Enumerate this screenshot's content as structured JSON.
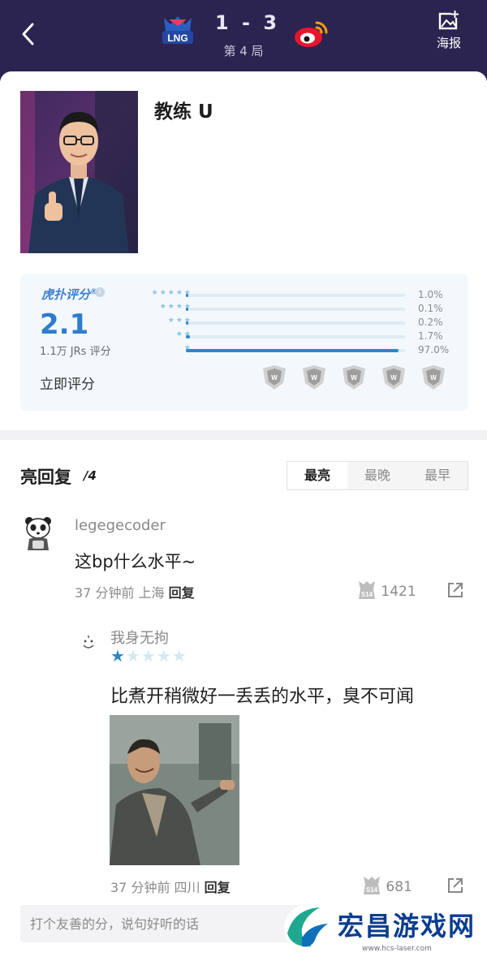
{
  "header": {
    "score": "1 - 3",
    "game_no": "第 4 局",
    "poster_label": "海报",
    "team_logo_text": "LNG",
    "bg_color": "#2b2350"
  },
  "profile": {
    "name": "教练 U"
  },
  "rating": {
    "brand": "虎扑评分",
    "brand_mark": "®",
    "score": "2.1",
    "count": "1.1万 JRs 评分",
    "rate_now": "立即评分",
    "accent_color": "#2f7ccc",
    "distribution": [
      {
        "stars": 5,
        "stars_label": "★★★★★",
        "percent": 1.0,
        "label": "1.0%"
      },
      {
        "stars": 4,
        "stars_label": "★★★★",
        "percent": 0.1,
        "label": "0.1%"
      },
      {
        "stars": 3,
        "stars_label": "★★★",
        "percent": 0.2,
        "label": "0.2%"
      },
      {
        "stars": 2,
        "stars_label": "★★",
        "percent": 1.7,
        "label": "1.7%"
      },
      {
        "stars": 1,
        "stars_label": "★",
        "percent": 97.0,
        "label": "97.0%"
      }
    ]
  },
  "comments": {
    "title": "亮回复",
    "count": "/4",
    "sort_tabs": [
      "最亮",
      "最晚",
      "最早"
    ],
    "active_sort": "最亮",
    "items": [
      {
        "user": "legegecoder",
        "text": "这bp什么水平~",
        "meta": "37 分钟前 上海",
        "reply_label": "回复",
        "likes": "1421"
      }
    ],
    "reply": {
      "user": "我身无拘",
      "rating_stars": 1,
      "text": "比煮开稍微好一丢丢的水平，臭不可闻",
      "meta": "37 分钟前 四川",
      "reply_label": "回复",
      "likes": "681"
    }
  },
  "input": {
    "placeholder": "打个友善的分，说句好听的话"
  },
  "watermark": {
    "text": "宏昌游戏网",
    "url": "www.hcs-laser.com"
  }
}
